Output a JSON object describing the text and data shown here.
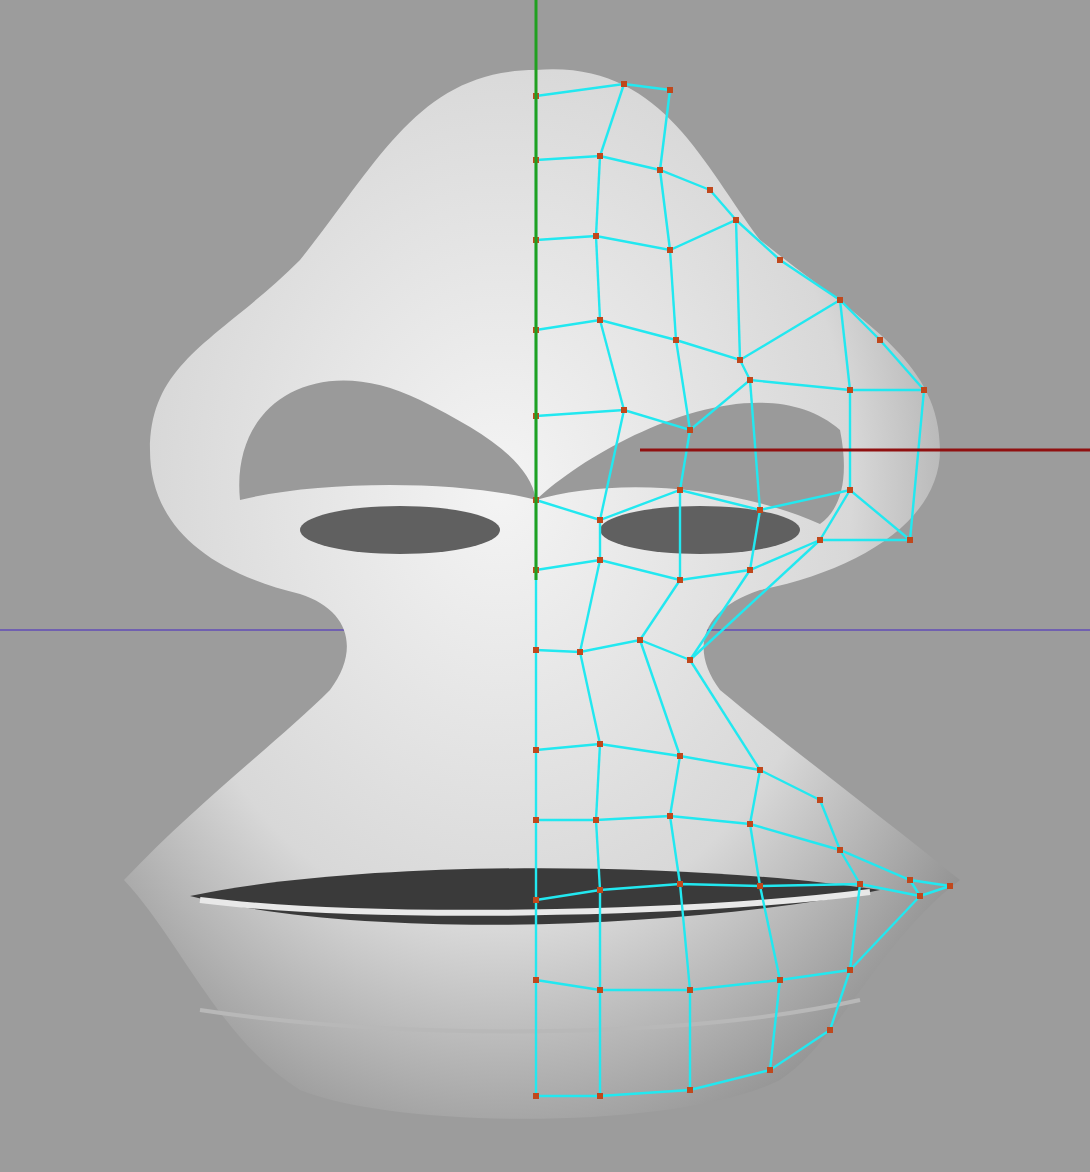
{
  "viewport": {
    "mesh_overlay": true
  }
}
